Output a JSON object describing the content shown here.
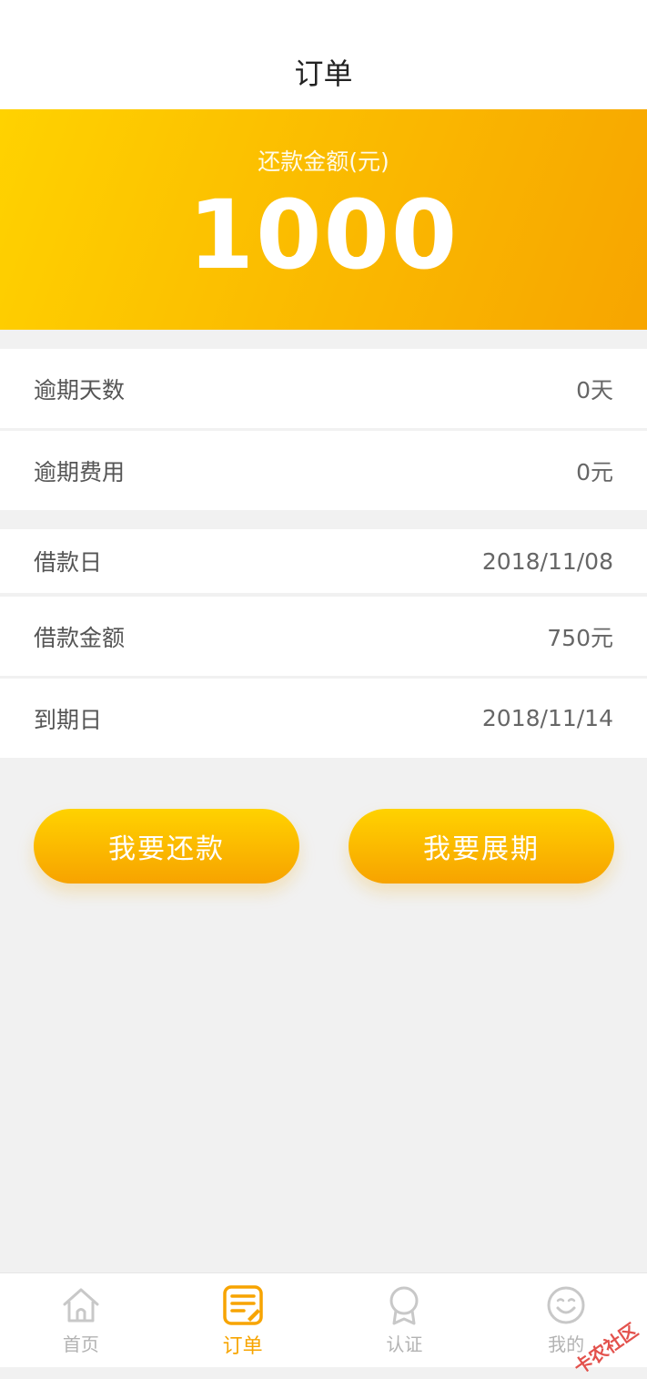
{
  "header": {
    "title": "订单"
  },
  "banner": {
    "label": "还款金额(元)",
    "amount": "1000"
  },
  "rows": [
    {
      "key": "逾期天数",
      "value": "0天"
    },
    {
      "key": "逾期费用",
      "value": "0元"
    },
    {
      "key": "借款日",
      "value": "2018/11/08"
    },
    {
      "key": "借款金额",
      "value": "750元"
    },
    {
      "key": "到期日",
      "value": "2018/11/14"
    }
  ],
  "actions": {
    "repay": "我要还款",
    "extend": "我要展期"
  },
  "tabbar": {
    "items": [
      {
        "label": "首页",
        "icon": "home-icon"
      },
      {
        "label": "订单",
        "icon": "order-icon",
        "active": true
      },
      {
        "label": "认证",
        "icon": "badge-icon"
      },
      {
        "label": "我的",
        "icon": "smiley-icon"
      }
    ]
  },
  "watermark": "卡农社区",
  "colors": {
    "accent": "#f7a400",
    "accent_light": "#ffd200"
  }
}
